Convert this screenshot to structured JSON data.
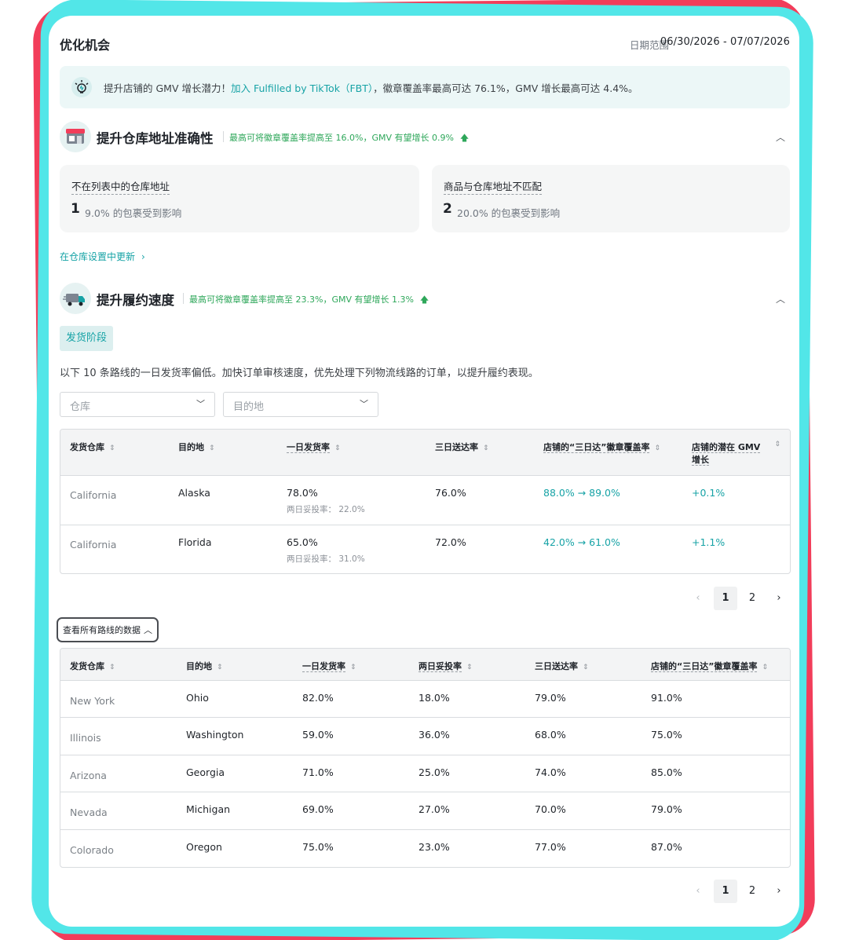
{
  "header": {
    "title": "优化机会",
    "date_label": "日期范围",
    "date_value": "06/30/2026 - 07/07/2026"
  },
  "banner": {
    "text_before": "提升店铺的 GMV 增长潜力！",
    "link": "加入 Fulfilled by TikTok（FBT）",
    "text_after": "，徽章覆盖率最高可达 76.1%，GMV 增长最高可达 4.4%。"
  },
  "warehouse_section": {
    "title": "提升仓库地址准确性",
    "note": "最高可将徽章覆盖率提高至 16.0%，GMV 有望增长 0.9%",
    "cards": [
      {
        "label": "不在列表中的仓库地址",
        "count": "1",
        "desc": "9.0% 的包裹受到影响"
      },
      {
        "label": "商品与仓库地址不匹配",
        "count": "2",
        "desc": "20.0% 的包裹受到影响"
      }
    ],
    "update_link": "在仓库设置中更新"
  },
  "fulfillment_section": {
    "title": "提升履约速度",
    "note": "最高可将徽章覆盖率提高至 23.3%，GMV 有望增长 1.3%",
    "stage_pill": "发货阶段",
    "description": "以下 10 条路线的一日发货率偏低。加快订单审核速度，优先处理下列物流线路的订单，以提升履约表现。",
    "filters": {
      "warehouse_placeholder": "仓库",
      "destination_placeholder": "目的地"
    },
    "table": {
      "headers": [
        "发货仓库",
        "目的地",
        "一日发货率",
        "三日送达率",
        "店铺的“三日达”徽章覆盖率",
        "店铺的潜在 GMV 增长"
      ],
      "sub_label": "两日妥投率：",
      "rows": [
        {
          "warehouse": "California",
          "destination": "Alaska",
          "one_day": "78.0%",
          "two_day": "22.0%",
          "three_day": "76.0%",
          "coverage": "88.0% → 89.0%",
          "gmv": "+0.1%"
        },
        {
          "warehouse": "California",
          "destination": "Florida",
          "one_day": "65.0%",
          "two_day": "31.0%",
          "three_day": "72.0%",
          "coverage": "42.0% → 61.0%",
          "gmv": "+1.1%"
        }
      ]
    },
    "pagination": {
      "prev": "‹",
      "pages": [
        "1",
        "2"
      ],
      "next": "›"
    }
  },
  "all_routes": {
    "toggle_label": "查看所有路线的数据",
    "headers": [
      "发货仓库",
      "目的地",
      "一日发货率",
      "两日妥投率",
      "三日送达率",
      "店铺的“三日达”徽章覆盖率"
    ],
    "rows": [
      [
        "New York",
        "Ohio",
        "82.0%",
        "18.0%",
        "79.0%",
        "91.0%"
      ],
      [
        "Illinois",
        "Washington",
        "59.0%",
        "36.0%",
        "68.0%",
        "75.0%"
      ],
      [
        "Arizona",
        "Georgia",
        "71.0%",
        "25.0%",
        "74.0%",
        "85.0%"
      ],
      [
        "Nevada",
        "Michigan",
        "69.0%",
        "27.0%",
        "70.0%",
        "79.0%"
      ],
      [
        "Colorado",
        "Oregon",
        "75.0%",
        "23.0%",
        "77.0%",
        "87.0%"
      ]
    ],
    "pagination": {
      "prev": "‹",
      "pages": [
        "1",
        "2"
      ],
      "next": "›"
    }
  },
  "colors": {
    "accent": "#17a3a6",
    "success": "#2ea75a",
    "frame_red": "#f23d5a",
    "frame_cyan": "#52e6e8"
  }
}
